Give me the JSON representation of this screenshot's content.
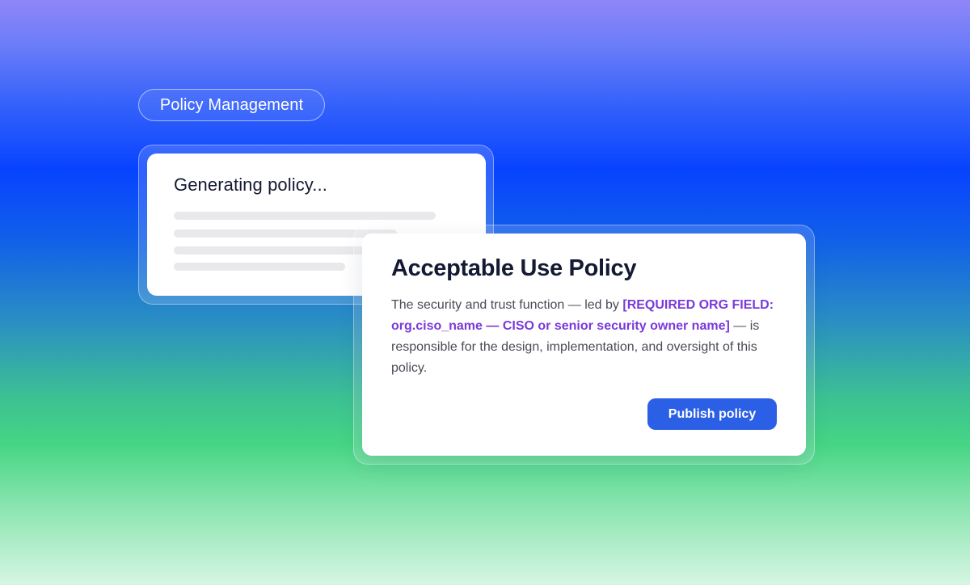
{
  "header": {
    "tag_label": "Policy Management"
  },
  "generating_card": {
    "title": "Generating policy...",
    "progress_lines": 4
  },
  "policy_card": {
    "title": "Acceptable Use Policy",
    "body_prefix": "The security and trust function — led by ",
    "required_field": "[REQUIRED ORG FIELD: org.ciso_name — CISO or senior security owner name]",
    "body_suffix": " — is responsible for the design, implementation, and oversight of this policy.",
    "publish_label": "Publish policy"
  },
  "colors": {
    "accent_button": "#2a5fe6",
    "highlight_text": "#7a3ad9",
    "title_text": "#141a33"
  }
}
